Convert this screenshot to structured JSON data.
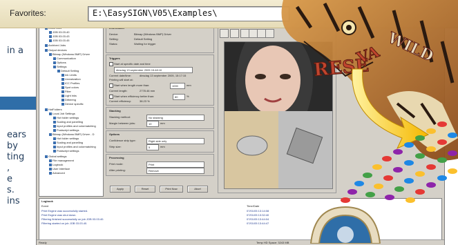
{
  "left_text": {
    "lines": [
      "in a",
      "ears",
      "by",
      "ting",
      ",",
      "e",
      "s.",
      "ins"
    ]
  },
  "favorites": {
    "label": "Favorites:",
    "path": "E:\\EasySIGN\\V05\\Examples\\"
  },
  "tree": {
    "items": [
      "Local Jobs",
      "JOB 03.03.40",
      "JOB 03.03.43",
      "JOB 03.03.45",
      "Archived Jobs",
      "Output devices",
      "Bitmap (Windows BMP) Driver",
      "Communication",
      "Options",
      "Settings",
      "Default Setting",
      "Ink Limits",
      "Linearization",
      "ICC Profiles",
      "Spot colors",
      "Filter",
      "Light inks",
      "Dithering",
      "Device specific",
      "HotFolders",
      "Local Job Settings",
      "Hot folder settings",
      "Scaling and panelling",
      "Input profiles and colormatching",
      "Postscript settings",
      "Bitmap (Windows BMP) Driver - D",
      "Hot folder settings",
      "Scaling and panelling",
      "Input profiles and colormatching",
      "Postscript settings",
      "Global settings",
      "File management",
      "Logbook",
      "User Interface",
      "Advanced"
    ]
  },
  "information": {
    "title": "Information",
    "rows": [
      {
        "label": "Device:",
        "value": "Bitmap (Windows BMP) Driver"
      },
      {
        "label": "Setting:",
        "value": "Default Setting"
      },
      {
        "label": "Status:",
        "value": "Waiting for trigger"
      }
    ]
  },
  "triggers": {
    "title": "Triggers",
    "start_at_label": "Start at specific date and time",
    "start_at_value": "dinsdag 13 september 2005 15:48:10",
    "current_time_label": "Current date/time:",
    "current_time_value": "dinsdag 13 september 2005, 15:17:15",
    "printing_label": "Printing will start at:",
    "length_label": "Start when length more than:",
    "length_value": "1000",
    "length_unit": "mm",
    "current_length_label": "Current length:",
    "current_length_value": "2778.46 mm",
    "efficiency_label": "Start when efficiency better than:",
    "efficiency_value": "80",
    "efficiency_unit": "%",
    "current_eff_label": "Current efficiency:",
    "current_eff_value": "38.23 %"
  },
  "stacking": {
    "title": "Stacking",
    "method_label": "Stacking method:",
    "method_value": "No stacking",
    "margin_label": "Margin between jobs:",
    "margin_value": "10",
    "margin_unit": "mm"
  },
  "options": {
    "title": "Options",
    "confidence_label": "Confidence strip type:",
    "confidence_value": "Right side only",
    "size_label": "Strip size:",
    "size_value": "5",
    "size_unit": "mm"
  },
  "processing": {
    "title": "Processing",
    "print_mode_label": "Print mode:",
    "print_mode_value": "Print",
    "after_label": "After printing:",
    "after_value": "Remove"
  },
  "buttons": {
    "apply": "Apply",
    "reset": "Reset",
    "print_now": "Print Now",
    "abort": "Abort"
  },
  "preview": {
    "title": "Preview"
  },
  "logbook": {
    "title": "Logbook",
    "headers": [
      "Event",
      "Time/Date"
    ],
    "rows": [
      {
        "event": "Print Engine was successfully started.",
        "time": "07/01/05 13:14:08"
      },
      {
        "event": "Print Engine was shut down.",
        "time": "07/01/05 13:32:40"
      },
      {
        "event": "Filtering finished successfully on job JOB 03.03.40.",
        "time": "07/01/05 13:44:04"
      },
      {
        "event": "Filtering started on job JOB 03.03.40.",
        "time": "07/01/05 13:44:47"
      }
    ]
  },
  "status": {
    "left": "Ready",
    "right": "Temp HD Space: 3243 MB"
  },
  "colors": {
    "accent_blue": "#2f6ea8",
    "window_bg": "#d4d0c8",
    "favbar_bg": "#efe6c6",
    "arrow_yellow": "#f5c51e"
  }
}
